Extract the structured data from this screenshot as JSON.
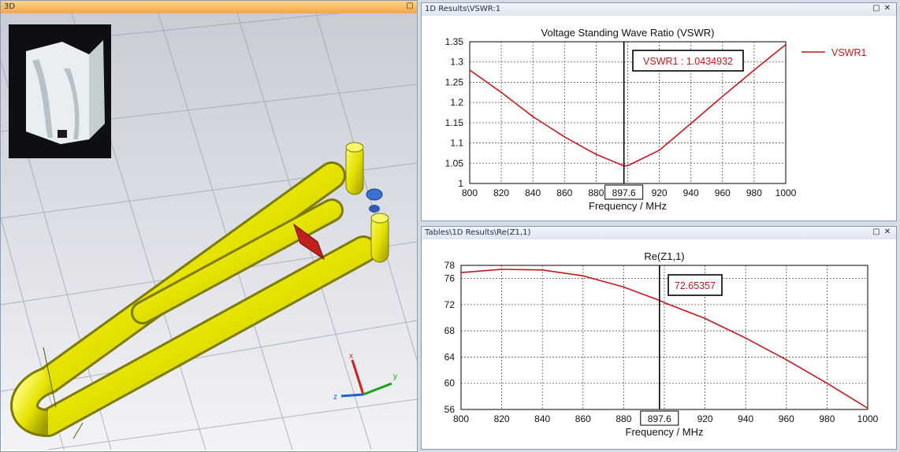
{
  "panes": {
    "view3d": {
      "title": "3D"
    },
    "vswr": {
      "title": "1D Results\\VSWR:1"
    },
    "rez": {
      "title": "Tables\\1D Results\\Re(Z1,1)"
    }
  },
  "window_buttons": {
    "maximize": "▢",
    "close": "✕"
  },
  "axes_triad": {
    "x": "x",
    "y": "y",
    "z": "z"
  },
  "colors": {
    "trace": "#c8161d",
    "tube": "#e8e400",
    "port": "#c0201d"
  },
  "chart_data": [
    {
      "type": "line",
      "title": "Voltage Standing Wave Ratio (VSWR)",
      "xlabel": "Frequency / MHz",
      "ylabel": "",
      "xlim": [
        800,
        1000
      ],
      "ylim": [
        1,
        1.35
      ],
      "xticks": [
        800,
        820,
        840,
        860,
        880,
        900,
        920,
        940,
        960,
        980,
        1000
      ],
      "yticks": [
        "1",
        "1.05",
        "1.1",
        "1.15",
        "1.2",
        "1.25",
        "1.3",
        "1.35"
      ],
      "series": [
        {
          "name": "VSWR1",
          "x": [
            800,
            820,
            840,
            860,
            880,
            897.6,
            900,
            920,
            940,
            960,
            980,
            1000
          ],
          "y": [
            1.28,
            1.225,
            1.165,
            1.115,
            1.072,
            1.0434932,
            1.044,
            1.082,
            1.148,
            1.215,
            1.28,
            1.343
          ]
        }
      ],
      "legend": "top-right",
      "marker": {
        "x": 897.6,
        "x_label": "897.6",
        "readout": "VSWR1 : 1.0434932"
      }
    },
    {
      "type": "line",
      "title": "Re(Z1,1)",
      "xlabel": "Frequency / MHz",
      "ylabel": "",
      "xlim": [
        800,
        1000
      ],
      "ylim": [
        56,
        78
      ],
      "xticks": [
        800,
        820,
        840,
        860,
        880,
        900,
        920,
        940,
        960,
        980,
        1000
      ],
      "yticks": [
        "56",
        "60",
        "64",
        "68",
        "72",
        "76",
        "78"
      ],
      "series": [
        {
          "name": "Re(Z1,1)",
          "x": [
            800,
            820,
            840,
            860,
            880,
            897.6,
            900,
            920,
            940,
            960,
            980,
            1000
          ],
          "y": [
            76.9,
            77.4,
            77.3,
            76.4,
            74.7,
            72.65357,
            72.3,
            69.9,
            66.9,
            63.6,
            60.0,
            56.2
          ]
        }
      ],
      "marker": {
        "x": 897.6,
        "x_label": "897.6",
        "readout": "72.65357"
      }
    }
  ]
}
